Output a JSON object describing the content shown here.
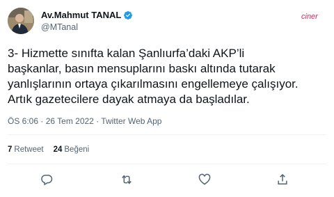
{
  "author": {
    "display_name": "Av.Mahmut TANAL",
    "handle": "@MTanal",
    "verified": true,
    "avatar_icon": "profile-photo"
  },
  "logo": {
    "text": "ciner"
  },
  "tweet": {
    "lines": [
      "3- Hizmette sınıfta kalan Şanlıurfa’daki AKP’li",
      "başkanlar, basın mensuplarını baskı altında tutarak",
      "yanlışlarının ortaya çıkarılmasını engellemeye çalışıyor.",
      "Artık gazetecilere dayak atmaya da başladılar."
    ],
    "meta": "ÖS 6:06 · 26 Tem 2022 · Twitter Web App"
  },
  "stats": {
    "retweets_count": "7",
    "retweets_label": "Retweet",
    "likes_count": "24",
    "likes_label": "Beğeni"
  },
  "actions": [
    "reply-icon",
    "retweet-icon",
    "like-icon",
    "share-icon"
  ],
  "colors": {
    "text": "#0f1419",
    "secondary": "#536471",
    "verified": "#1d9bf0",
    "divider": "#eff3f4",
    "logo": "#e0245e"
  }
}
